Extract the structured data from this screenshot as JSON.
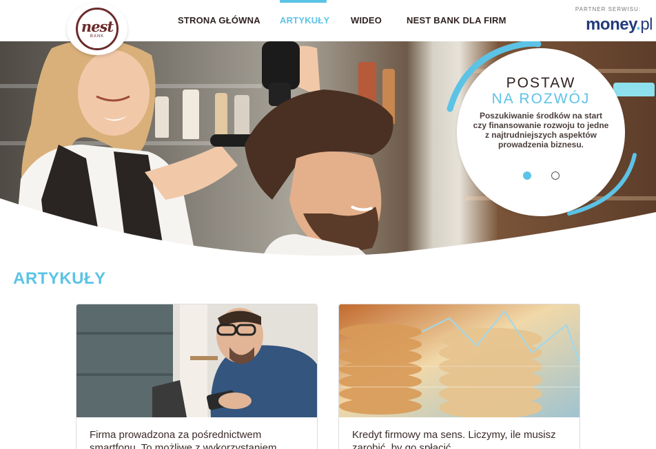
{
  "header": {
    "logo_text": "nest",
    "logo_subtext": "BANK",
    "nav": [
      {
        "label": "STRONA GŁÓWNA",
        "active": false
      },
      {
        "label": "ARTYKUŁY",
        "active": true
      },
      {
        "label": "WIDEO",
        "active": false
      },
      {
        "label": "NEST BANK DLA FIRM",
        "active": false
      }
    ],
    "partner_label": "PARTNER SERWISU:",
    "partner_brand": "money",
    "partner_brand_dot": ".",
    "partner_brand_tld": "pl"
  },
  "hero": {
    "title_line1": "POSTAW",
    "title_line2": "NA ROZWÓJ",
    "text": "Poszukiwanie środków na start czy finansowanie rozwoju to jedne z najtrudniejszych aspektów prowadzenia biznesu.",
    "slides_total": 2,
    "active_slide": 1
  },
  "section": {
    "title": "ARTYKUŁY"
  },
  "articles": [
    {
      "title": "Firma prowadzona za pośrednictwem smartfonu. To możliwe z wykorzystaniem"
    },
    {
      "title": "Kredyt firmowy ma sens. Liczymy, ile musisz zarobić, by go spłacić"
    }
  ],
  "colors": {
    "accent": "#5cc3e6",
    "brand": "#6b2b2b",
    "text": "#3a2a28",
    "money_brand": "#243a7a"
  }
}
